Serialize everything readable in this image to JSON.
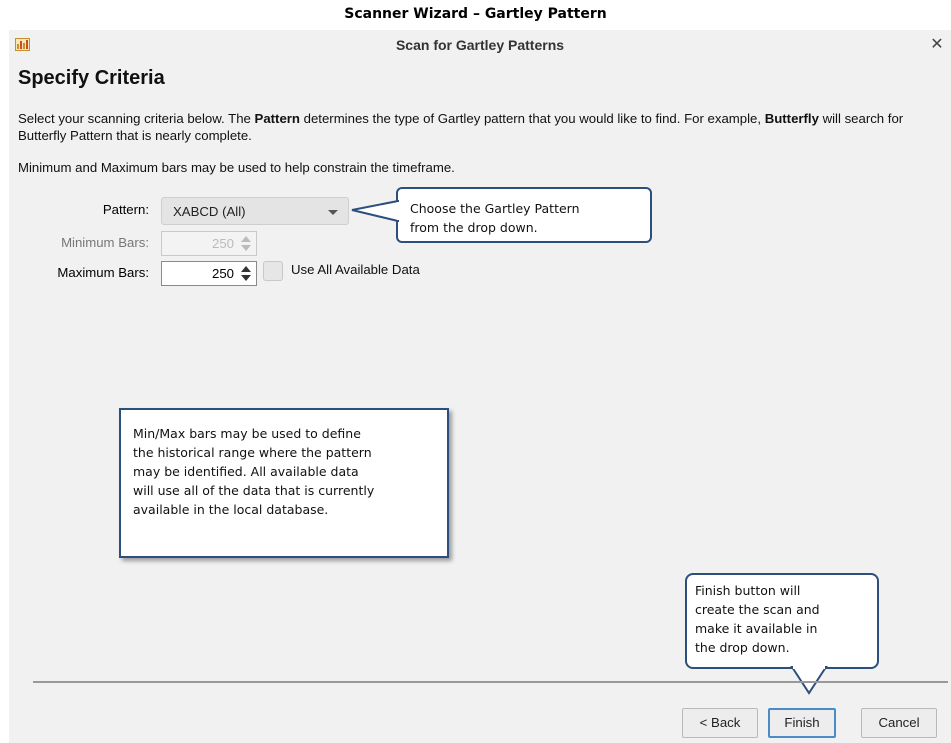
{
  "doc_title": "Scanner Wizard – Gartley Pattern",
  "window": {
    "title": "Scan for Gartley Patterns",
    "close_glyph": "✕"
  },
  "heading": "Specify Criteria",
  "description": {
    "part1": "Select your scanning criteria below.  The ",
    "bold1": "Pattern",
    "part2": " determines the type of Gartley pattern that you would like to find.  For example, ",
    "bold2": "Butterfly",
    "part3": " will search for Butterfly Pattern that is nearly complete."
  },
  "description2": "Minimum and Maximum bars may be used to help constrain the timeframe.",
  "form": {
    "pattern_label": "Pattern:",
    "pattern_value": "XABCD (All)",
    "min_bars_label": "Minimum Bars:",
    "min_bars_value": "250",
    "max_bars_label": "Maximum Bars:",
    "max_bars_value": "250",
    "use_all_label": "Use All Available Data"
  },
  "callouts": {
    "pattern": "Choose the Gartley Pattern\nfrom the drop down.",
    "bars": "Min/Max bars may be used to define\nthe historical range where the pattern\nmay be identified.  All available data\nwill use all of the data that is currently\navailable in the local database.",
    "finish": "Finish button will\ncreate the scan and\nmake it available in\nthe drop down."
  },
  "buttons": {
    "back": "< Back",
    "finish": "Finish",
    "cancel": "Cancel"
  },
  "colors": {
    "callout_border": "#2d4f7c",
    "primary_button_border": "#4b8cc7",
    "dialog_background": "#f1f1f1"
  }
}
